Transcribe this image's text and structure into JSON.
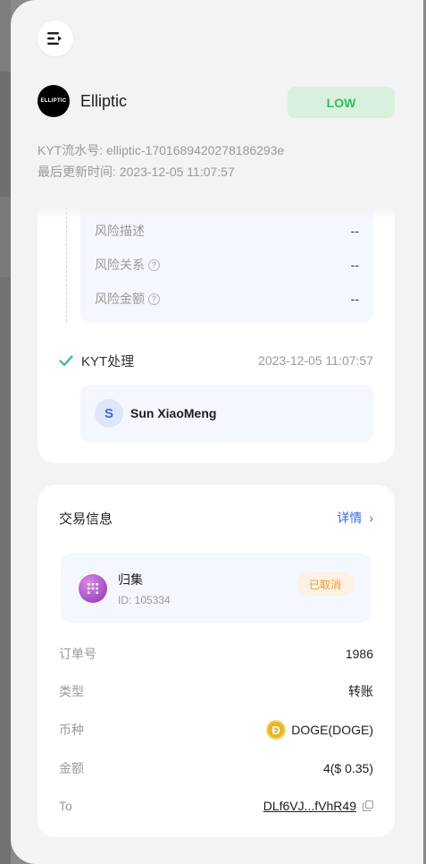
{
  "provider": {
    "logo_text": "ELLIPTIC",
    "name": "Elliptic",
    "risk_level": "LOW",
    "kyt_serial": "KYT流水号: elliptic-1701689420278186293e",
    "last_updated": "最后更新时间: 2023-12-05 11:07:57"
  },
  "risk_details": [
    {
      "label": "风险描述",
      "value": "--",
      "has_help": false
    },
    {
      "label": "风险关系",
      "value": "--",
      "has_help": true
    },
    {
      "label": "风险金额",
      "value": "--",
      "has_help": true
    }
  ],
  "kyt_step": {
    "title": "KYT处理",
    "time": "2023-12-05 11:07:57",
    "user_initial": "S",
    "user_name": "Sun XiaoMeng"
  },
  "transaction": {
    "section_title": "交易信息",
    "details_link": "详情",
    "summary_name": "归集",
    "summary_id": "ID: 105334",
    "status": "已取消",
    "order_label": "订单号",
    "order_value": "1986",
    "type_label": "类型",
    "type_value": "转账",
    "currency_label": "币种",
    "currency_value": "DOGE(DOGE)",
    "currency_icon_letter": "Ð",
    "amount_label": "金额",
    "amount_value": "4($ 0.35)",
    "to_label": "To",
    "to_value": "DLf6VJ...fVhR49"
  },
  "colors": {
    "accent": "#3f66e0",
    "risk_low_bg": "#d9f0df",
    "risk_low_text": "#2fbe63",
    "status_cancel": "#f09a32"
  },
  "icons": {
    "menu": "menu-collapse-icon",
    "check": "check-icon",
    "help": "help-circle-icon",
    "copy": "copy-icon",
    "chevron": "chevron-right-icon"
  }
}
